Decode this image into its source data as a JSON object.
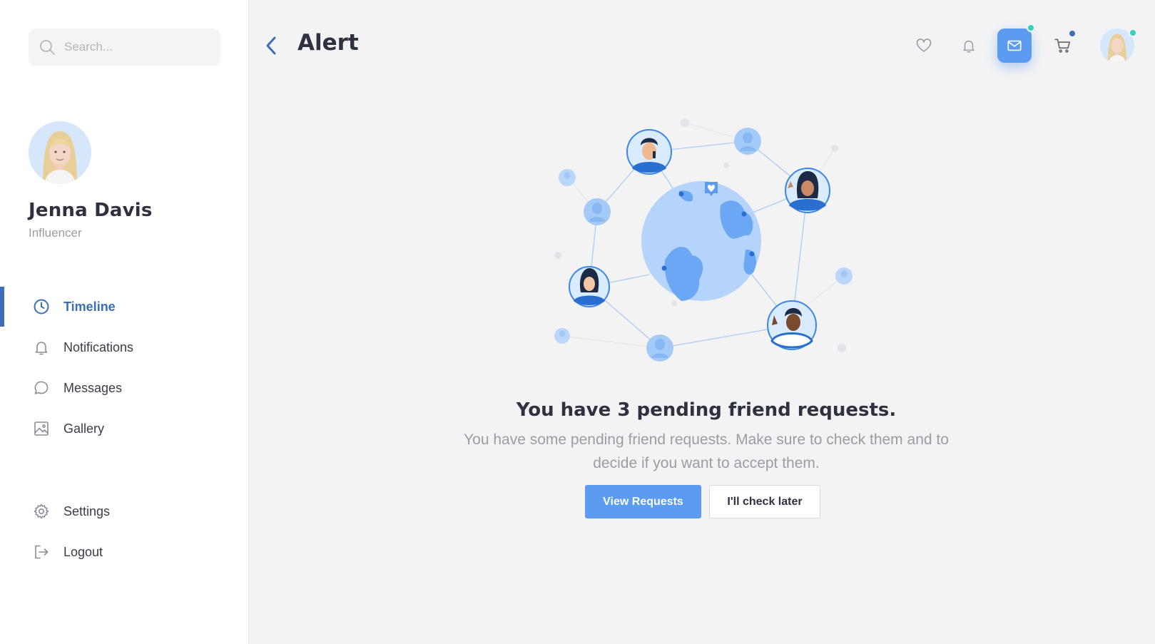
{
  "search": {
    "placeholder": "Search..."
  },
  "profile": {
    "name": "Jenna Davis",
    "role": "Influencer"
  },
  "sidebar": {
    "items": [
      {
        "label": "Timeline",
        "icon": "clock-icon",
        "active": true
      },
      {
        "label": "Notifications",
        "icon": "bell-icon",
        "active": false
      },
      {
        "label": "Messages",
        "icon": "chat-icon",
        "active": false
      },
      {
        "label": "Gallery",
        "icon": "image-icon",
        "active": false
      },
      {
        "label": "Settings",
        "icon": "gear-icon",
        "active": false
      },
      {
        "label": "Logout",
        "icon": "logout-icon",
        "active": false
      }
    ]
  },
  "header": {
    "title": "Alert",
    "icons": [
      "heart-icon",
      "bell-icon",
      "mail-icon",
      "cart-icon"
    ]
  },
  "main": {
    "headline": "You have 3 pending friend requests.",
    "subtext": "You have some pending friend requests. Make sure to check them and to decide if you want to accept them.",
    "primary_button": "View Requests",
    "secondary_button": "I'll check later"
  },
  "colors": {
    "accent": "#3d6fb8",
    "button_blue": "#5b9cf0",
    "online_dot": "#34d1bf",
    "cart_dot": "#3d6fb8"
  }
}
